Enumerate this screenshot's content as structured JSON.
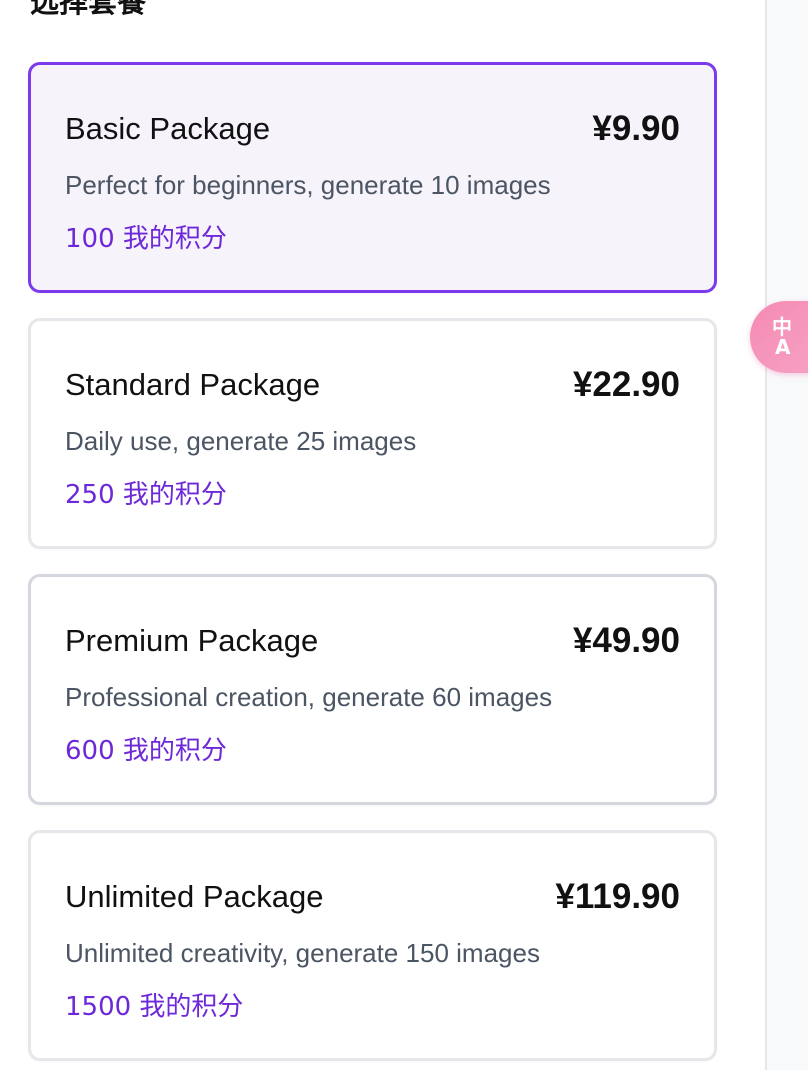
{
  "section": {
    "title": "选择套餐"
  },
  "packages": [
    {
      "name": "Basic Package",
      "price": "¥9.90",
      "description": "Perfect for beginners, generate 10 images",
      "points": "100 我的积分",
      "selected": true
    },
    {
      "name": "Standard Package",
      "price": "¥22.90",
      "description": "Daily use, generate 25 images",
      "points": "250 我的积分",
      "selected": false
    },
    {
      "name": "Premium Package",
      "price": "¥49.90",
      "description": "Professional creation, generate 60 images",
      "points": "600 我的积分",
      "selected": false
    },
    {
      "name": "Unlimited Package",
      "price": "¥119.90",
      "description": "Unlimited creativity, generate 150 images",
      "points": "1500 我的积分",
      "selected": false
    }
  ],
  "translate_button": {
    "icon": "translate-icon",
    "glyph_top": "中",
    "glyph_bottom": "A"
  },
  "colors": {
    "accent": "#7c3aed",
    "points_text": "#6d28d9",
    "selected_background": "#f6f3fb",
    "card_border": "#e5e7eb",
    "translate_button": "#f58ab3"
  }
}
